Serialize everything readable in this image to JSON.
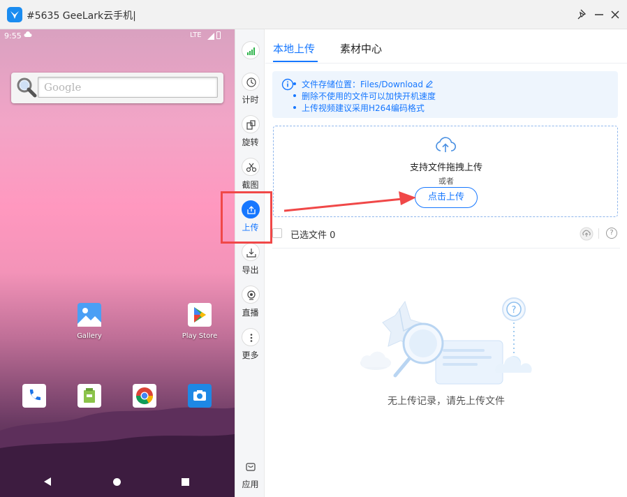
{
  "window": {
    "title": "#5635 GeeLark云手机|",
    "logo_icon": "geelark-logo-icon",
    "buttons": [
      "pin-icon",
      "minimize-icon",
      "close-icon"
    ]
  },
  "phone": {
    "status": {
      "time": "9:55",
      "network": "LTE"
    },
    "search_widget": {
      "placeholder": "Google"
    },
    "apps": [
      {
        "label": "Gallery",
        "icon": "gallery-icon"
      },
      {
        "label": "Play Store",
        "icon": "play-store-icon"
      }
    ],
    "dock": [
      "phone-icon",
      "files-icon",
      "chrome-icon",
      "camera-icon"
    ],
    "nav": [
      "back-icon",
      "home-icon",
      "recents-icon"
    ]
  },
  "sidebar": {
    "items": [
      {
        "label": "",
        "icon": "signal-icon"
      },
      {
        "label": "计时",
        "icon": "clock-icon"
      },
      {
        "label": "旋转",
        "icon": "rotate-icon"
      },
      {
        "label": "截图",
        "icon": "scissors-icon"
      },
      {
        "label": "上传",
        "icon": "upload-icon",
        "active": true
      },
      {
        "label": "导出",
        "icon": "download-icon"
      },
      {
        "label": "直播",
        "icon": "webcam-icon"
      },
      {
        "label": "更多",
        "icon": "more-icon"
      },
      {
        "label": "应用",
        "icon": "bag-icon"
      }
    ]
  },
  "main": {
    "tabs": [
      {
        "label": "本地上传",
        "active": true
      },
      {
        "label": "素材中心",
        "active": false
      }
    ],
    "info": {
      "lines": [
        "文件存储位置：Files/Download",
        "删除不使用的文件可以加快开机速度",
        "上传视频建议采用H264编码格式"
      ]
    },
    "drop_zone": {
      "title": "支持文件拖拽上传",
      "or": "或者",
      "button": "点击上传"
    },
    "selected": {
      "label": "已选文件",
      "count": "0"
    },
    "empty": {
      "text": "无上传记录，请先上传文件"
    }
  },
  "colors": {
    "accent": "#1677ff",
    "annotation": "#f04848"
  }
}
